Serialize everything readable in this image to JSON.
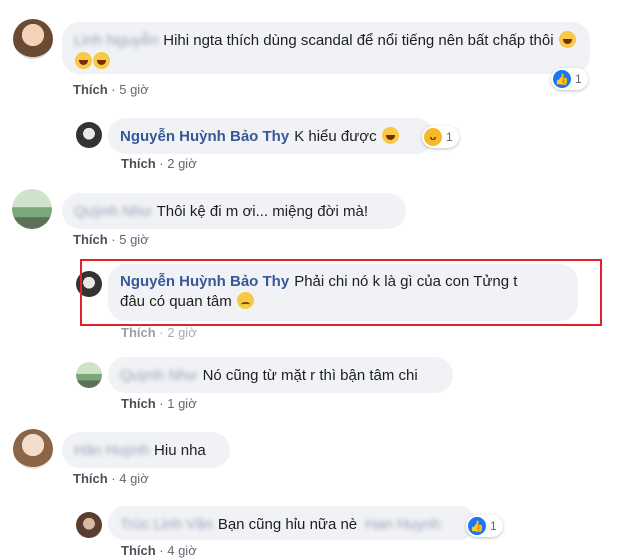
{
  "comments": [
    {
      "name": "Linh Nguyễn",
      "text": "Hihi ngta thích dùng scandal để nổi tiếng nên bất chấp thôi",
      "like": "Thích",
      "time": "5 giờ",
      "reaction_count": "1"
    },
    {
      "name": "Nguyễn Huỳnh Bảo Thy",
      "text": "K hiểu được",
      "like": "Thích",
      "time": "2 giờ",
      "reaction_count": "1"
    },
    {
      "name": "Quỳnh Như",
      "text": "Thôi kệ đi m ơi... miệng đời mà!",
      "like": "Thích",
      "time": "5 giờ"
    },
    {
      "name": "Nguyễn Huỳnh Bảo Thy",
      "text_line1": "Phải chi nó k là gì của con Tửng t",
      "text_line2": "đâu có quan tâm",
      "like": "Thích",
      "time": "2 giờ"
    },
    {
      "name": "Quỳnh Như",
      "text": "Nó cũng từ mặt r thì bận tâm chi",
      "like": "Thích",
      "time": "1 giờ"
    },
    {
      "name": "Hân Huỳnh",
      "text": "Hiu nha",
      "like": "Thích",
      "time": "4 giờ"
    },
    {
      "name": "Trúc Linh Văn",
      "text": "Bạn cũng hỉu nữa nè",
      "mention": "Han Huynh",
      "like": "Thích",
      "time": "4 giờ",
      "reaction_count": "1"
    }
  ],
  "colors": {
    "link": "#385898",
    "bubble": "#f0f2f5",
    "highlight": "#e0222c",
    "like_blue": "#1877f2"
  },
  "icons": {
    "like": "thumbs-up-icon",
    "haha": "haha-icon",
    "laugh": "laughing-emoji-icon",
    "sad": "sad-emoji-icon"
  }
}
